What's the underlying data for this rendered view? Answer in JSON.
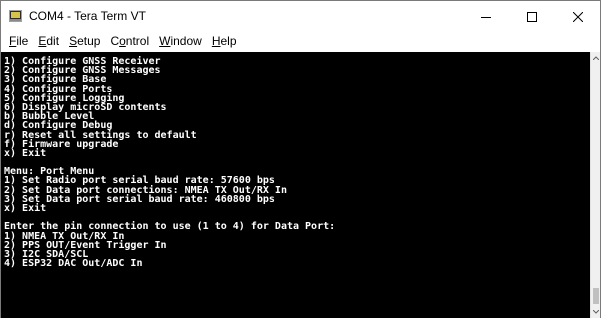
{
  "window": {
    "title": "COM4 - Tera Term VT",
    "icon": "tera-term-icon"
  },
  "controls": {
    "minimize": "minimize-icon",
    "maximize": "maximize-icon",
    "close": "close-icon"
  },
  "menubar": {
    "items": [
      {
        "accel": "F",
        "rest": "ile"
      },
      {
        "accel": "E",
        "rest": "dit"
      },
      {
        "accel": "S",
        "rest": "etup"
      },
      {
        "pre": "C",
        "accel": "o",
        "rest": "ntrol"
      },
      {
        "accel": "W",
        "rest": "indow"
      },
      {
        "accel": "H",
        "rest": "elp"
      }
    ]
  },
  "terminal": {
    "lines": [
      "1) Configure GNSS Receiver",
      "2) Configure GNSS Messages",
      "3) Configure Base",
      "4) Configure Ports",
      "5) Configure Logging",
      "6) Display microSD contents",
      "b) Bubble Level",
      "d) Configure Debug",
      "r) Reset all settings to default",
      "f) Firmware upgrade",
      "x) Exit",
      "",
      "Menu: Port Menu",
      "1) Set Radio port serial baud rate: 57600 bps",
      "2) Set Data port connections: NMEA TX Out/RX In",
      "3) Set Data port serial baud rate: 460800 bps",
      "x) Exit",
      "",
      "Enter the pin connection to use (1 to 4) for Data Port:",
      "1) NMEA TX Out/RX In",
      "2) PPS OUT/Event Trigger In",
      "3) I2C SDA/SCL",
      "4) ESP32 DAC Out/ADC In"
    ]
  }
}
